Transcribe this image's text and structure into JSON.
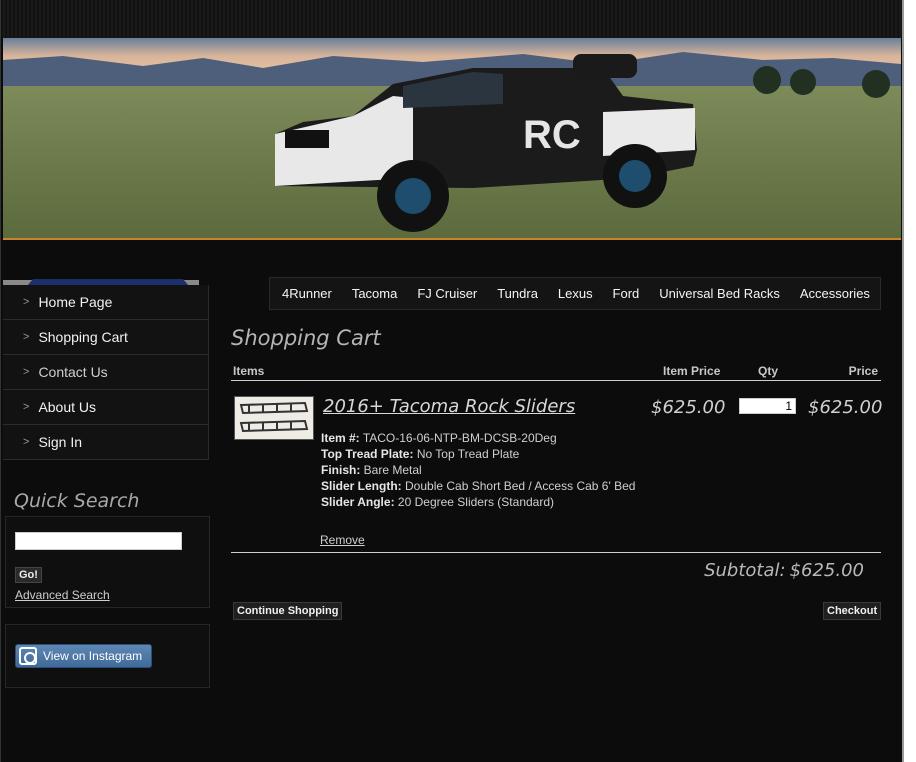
{
  "sidebar": {
    "items": [
      {
        "label": "Home Page"
      },
      {
        "label": "Shopping Cart"
      },
      {
        "label": "Contact Us"
      },
      {
        "label": "About Us"
      },
      {
        "label": "Sign In"
      }
    ],
    "chevron": ">"
  },
  "quick_search": {
    "title": "Quick Search",
    "input_value": "",
    "go_label": "Go!",
    "advanced_label": "Advanced Search"
  },
  "instagram": {
    "label": "View on Instagram",
    "icon": "instagram-icon"
  },
  "top_nav": {
    "items": [
      {
        "label": "4Runner"
      },
      {
        "label": "Tacoma"
      },
      {
        "label": "FJ Cruiser"
      },
      {
        "label": "Tundra"
      },
      {
        "label": "Lexus"
      },
      {
        "label": "Ford"
      },
      {
        "label": "Universal Bed Racks"
      },
      {
        "label": "Accessories"
      }
    ]
  },
  "cart": {
    "title": "Shopping Cart",
    "columns": {
      "items": "Items",
      "item_price": "Item Price",
      "qty": "Qty",
      "price": "Price"
    },
    "item": {
      "name": "2016+ Tacoma Rock Sliders",
      "item_price": "$625.00",
      "qty": "1",
      "price": "$625.00",
      "details": [
        {
          "label": "Item #:",
          "value": "TACO-16-06-NTP-BM-DCSB-20Deg"
        },
        {
          "label": "Top Tread Plate:",
          "value": "No Top Tread Plate"
        },
        {
          "label": "Finish:",
          "value": "Bare Metal"
        },
        {
          "label": "Slider Length:",
          "value": "Double Cab Short Bed / Access Cab 6' Bed"
        },
        {
          "label": "Slider Angle:",
          "value": "20 Degree Sliders (Standard)"
        }
      ],
      "remove_label": "Remove"
    },
    "subtotal_label": "Subtotal:",
    "subtotal_value": "$625.00",
    "continue_label": "Continue Shopping",
    "checkout_label": "Checkout"
  },
  "colors": {
    "background": "#0c0c0c",
    "accent_line": "#c9852b",
    "instagram_blue": "#4f78a6"
  }
}
